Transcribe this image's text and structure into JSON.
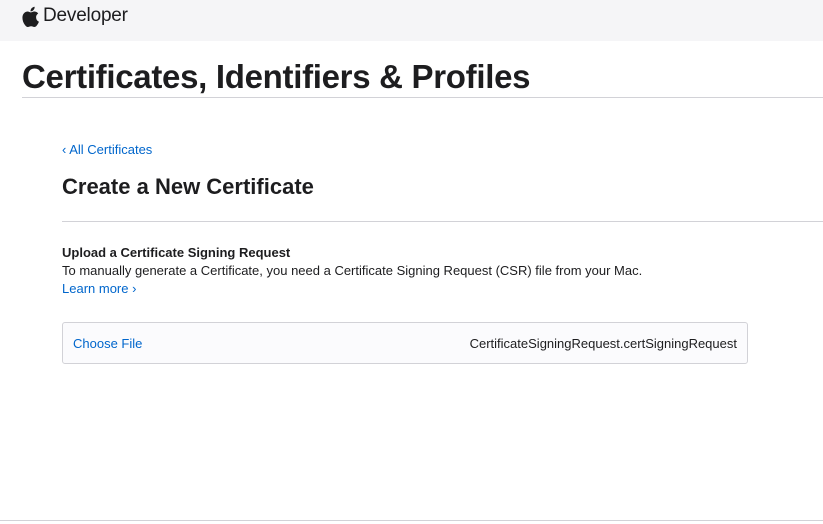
{
  "header": {
    "brand_text": "Developer",
    "logo_icon": "apple-logo-icon"
  },
  "page": {
    "title": "Certificates, Identifiers & Profiles"
  },
  "breadcrumb": {
    "back_label": "‹ All Certificates"
  },
  "section": {
    "title": "Create a New Certificate"
  },
  "upload": {
    "heading": "Upload a Certificate Signing Request",
    "description": "To manually generate a Certificate, you need a Certificate Signing Request (CSR) file from your Mac.",
    "learn_more": "Learn more ›",
    "choose_file_label": "Choose File",
    "file_name": "CertificateSigningRequest.certSigningRequest"
  },
  "colors": {
    "link": "#0066cc",
    "text": "#1d1d1f",
    "topbar_bg": "#f5f5f7",
    "rule": "#d2d2d7"
  }
}
